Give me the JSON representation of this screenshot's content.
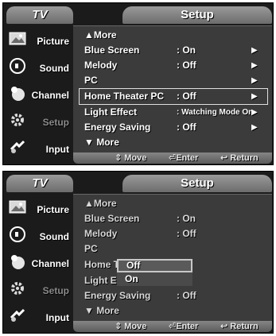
{
  "screens": [
    {
      "tab": "TV",
      "title": "Setup",
      "sidebar": [
        {
          "label": "Picture",
          "icon": "picture-icon",
          "disabled": false
        },
        {
          "label": "Sound",
          "icon": "sound-icon",
          "disabled": false
        },
        {
          "label": "Channel",
          "icon": "channel-icon",
          "disabled": false
        },
        {
          "label": "Setup",
          "icon": "setup-icon",
          "disabled": true
        },
        {
          "label": "Input",
          "icon": "input-icon",
          "disabled": false
        }
      ],
      "rows": [
        {
          "name": "▲More",
          "value": "",
          "arrow": ""
        },
        {
          "name": "Blue Screen",
          "value": ": On",
          "arrow": "▶"
        },
        {
          "name": "Melody",
          "value": ": Off",
          "arrow": "▶"
        },
        {
          "name": "PC",
          "value": "",
          "arrow": "▶"
        },
        {
          "name": "Home Theater PC",
          "value": ": Off",
          "arrow": "▶"
        },
        {
          "name": "Light Effect",
          "value": ": Watching Mode On",
          "arrow": "▶"
        },
        {
          "name": "Energy  Saving",
          "value": ": Off",
          "arrow": "▶"
        },
        {
          "name": "▼ More",
          "value": "",
          "arrow": ""
        }
      ],
      "nav": {
        "move": "⇕ Move",
        "enter": "⏎Enter",
        "return": "↩ Return"
      }
    },
    {
      "tab": "TV",
      "title": "Setup",
      "sidebar": [
        {
          "label": "Picture",
          "icon": "picture-icon",
          "disabled": false
        },
        {
          "label": "Sound",
          "icon": "sound-icon",
          "disabled": false
        },
        {
          "label": "Channel",
          "icon": "channel-icon",
          "disabled": false
        },
        {
          "label": "Setup",
          "icon": "setup-icon",
          "disabled": true
        },
        {
          "label": "Input",
          "icon": "input-icon",
          "disabled": false
        }
      ],
      "rows": [
        {
          "name": "▲More",
          "value": ""
        },
        {
          "name": "Blue Screen",
          "value": ": On"
        },
        {
          "name": "Melody",
          "value": ": Off"
        },
        {
          "name": "PC",
          "value": ""
        },
        {
          "name": "Home Theater PC",
          "value": ""
        },
        {
          "name": "Light Effect",
          "value": ""
        },
        {
          "name": "Energy  Saving",
          "value": ": Off"
        },
        {
          "name": "▼ More",
          "value": ""
        }
      ],
      "dropdown": {
        "options": [
          "Off",
          "On"
        ],
        "selected": "Off"
      },
      "nav": {
        "move": "⇕ Move",
        "enter": "⏎Enter",
        "return": "↩ Return"
      }
    }
  ]
}
